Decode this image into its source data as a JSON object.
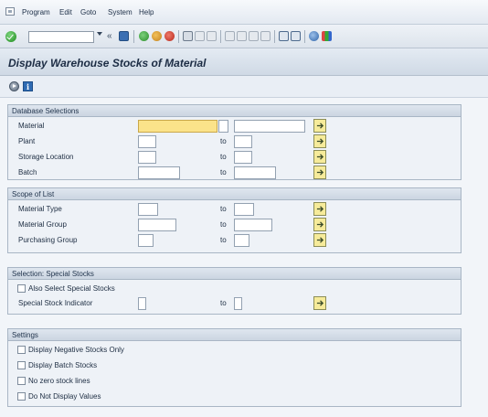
{
  "menu": {
    "items": [
      {
        "label": "Program"
      },
      {
        "label": "Edit"
      },
      {
        "label": "Goto"
      },
      {
        "label": "System"
      },
      {
        "label": "Help"
      }
    ]
  },
  "toolbar": {
    "command_field_value": "",
    "icons": [
      "enter-icon",
      "back-icon",
      "save-icon",
      "back-nav-icon",
      "exit-icon",
      "cancel-icon",
      "print-icon",
      "find-icon",
      "find-next-icon",
      "first-page-icon",
      "previous-page-icon",
      "next-page-icon",
      "last-page-icon",
      "create-session-icon",
      "shortcut-icon",
      "help-icon",
      "layout-menu-icon"
    ]
  },
  "title": "Display Warehouse Stocks of Material",
  "app_toolbar": {
    "icons": [
      "execute-icon",
      "program-info-icon"
    ]
  },
  "groups": {
    "database_selections": {
      "header": "Database Selections",
      "rows": [
        {
          "label": "Material",
          "to": "to",
          "low": "",
          "high": ""
        },
        {
          "label": "Plant",
          "to": "to",
          "low": "",
          "high": ""
        },
        {
          "label": "Storage Location",
          "to": "to",
          "low": "",
          "high": ""
        },
        {
          "label": "Batch",
          "to": "to",
          "low": "",
          "high": ""
        }
      ]
    },
    "scope_of_list": {
      "header": "Scope of List",
      "rows": [
        {
          "label": "Material Type",
          "to": "to",
          "low": "",
          "high": ""
        },
        {
          "label": "Material Group",
          "to": "to",
          "low": "",
          "high": ""
        },
        {
          "label": "Purchasing Group",
          "to": "to",
          "low": "",
          "high": ""
        }
      ]
    },
    "special_stocks": {
      "header": "Selection: Special Stocks",
      "checkbox_label": "Also Select Special Stocks",
      "checked": false,
      "row": {
        "label": "Special Stock Indicator",
        "to": "to",
        "low": "",
        "high": ""
      }
    },
    "settings": {
      "header": "Settings",
      "checkboxes": [
        {
          "label": "Display Negative Stocks Only",
          "checked": false
        },
        {
          "label": "Display Batch Stocks",
          "checked": false
        },
        {
          "label": "No zero stock lines",
          "checked": false
        },
        {
          "label": "Do Not Display Values",
          "checked": false
        }
      ]
    }
  },
  "colors": {
    "required_field": "#fbe38a",
    "multi_select_button": "#f6eb9a",
    "group_header": "#cbd5e1"
  }
}
